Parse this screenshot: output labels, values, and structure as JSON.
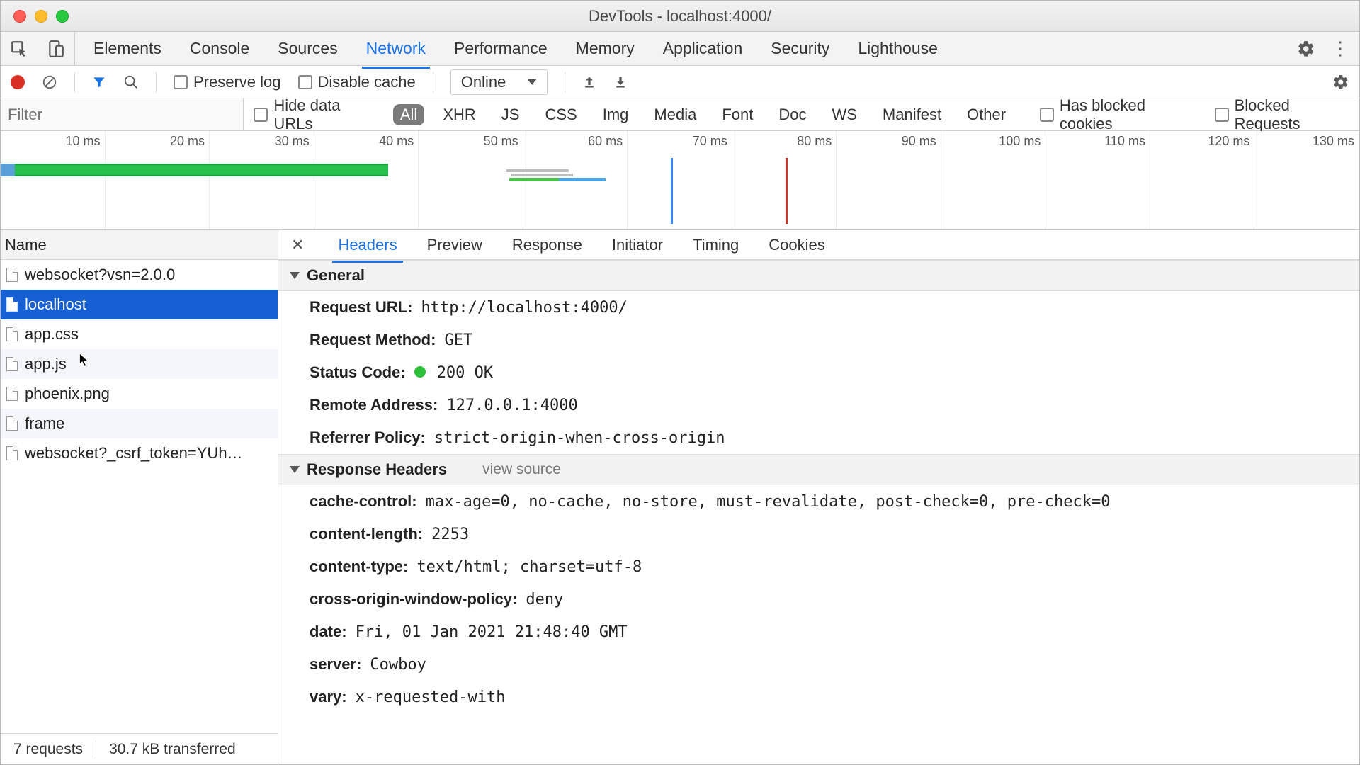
{
  "window": {
    "title": "DevTools - localhost:4000/"
  },
  "panels": {
    "items": [
      "Elements",
      "Console",
      "Sources",
      "Network",
      "Performance",
      "Memory",
      "Application",
      "Security",
      "Lighthouse"
    ],
    "active": 3
  },
  "net_toolbar": {
    "preserve_log": "Preserve log",
    "disable_cache": "Disable cache",
    "throttling": "Online"
  },
  "filter": {
    "placeholder": "Filter",
    "hide_data_urls": "Hide data URLs",
    "types": [
      "All",
      "XHR",
      "JS",
      "CSS",
      "Img",
      "Media",
      "Font",
      "Doc",
      "WS",
      "Manifest",
      "Other"
    ],
    "active_type": 0,
    "has_blocked_cookies": "Has blocked cookies",
    "blocked_requests": "Blocked Requests"
  },
  "timeline": {
    "ticks": [
      "10 ms",
      "20 ms",
      "30 ms",
      "40 ms",
      "50 ms",
      "60 ms",
      "70 ms",
      "80 ms",
      "90 ms",
      "100 ms",
      "110 ms",
      "120 ms",
      "130 ms"
    ]
  },
  "requests": {
    "name_header": "Name",
    "items": [
      {
        "name": "websocket?vsn=2.0.0"
      },
      {
        "name": "localhost"
      },
      {
        "name": "app.css"
      },
      {
        "name": "app.js"
      },
      {
        "name": "phoenix.png"
      },
      {
        "name": "frame"
      },
      {
        "name": "websocket?_csrf_token=YUh…"
      }
    ],
    "selected": 1,
    "summary": {
      "count": "7 requests",
      "transferred": "30.7 kB transferred"
    }
  },
  "detail_tabs": {
    "items": [
      "Headers",
      "Preview",
      "Response",
      "Initiator",
      "Timing",
      "Cookies"
    ],
    "active": 0
  },
  "headers": {
    "general_title": "General",
    "general": [
      {
        "k": "Request URL:",
        "v": "http://localhost:4000/",
        "mono": true
      },
      {
        "k": "Request Method:",
        "v": "GET",
        "mono": true
      },
      {
        "k": "Status Code:",
        "v": "200 OK",
        "mono": true,
        "status": true
      },
      {
        "k": "Remote Address:",
        "v": "127.0.0.1:4000",
        "mono": true
      },
      {
        "k": "Referrer Policy:",
        "v": "strict-origin-when-cross-origin",
        "mono": true
      }
    ],
    "response_title": "Response Headers",
    "view_source": "view source",
    "response": [
      {
        "k": "cache-control:",
        "v": "max-age=0, no-cache, no-store, must-revalidate, post-check=0, pre-check=0"
      },
      {
        "k": "content-length:",
        "v": "2253"
      },
      {
        "k": "content-type:",
        "v": "text/html; charset=utf-8"
      },
      {
        "k": "cross-origin-window-policy:",
        "v": "deny"
      },
      {
        "k": "date:",
        "v": "Fri, 01 Jan 2021 21:48:40 GMT"
      },
      {
        "k": "server:",
        "v": "Cowboy"
      },
      {
        "k": "vary:",
        "v": "x-requested-with"
      }
    ]
  }
}
